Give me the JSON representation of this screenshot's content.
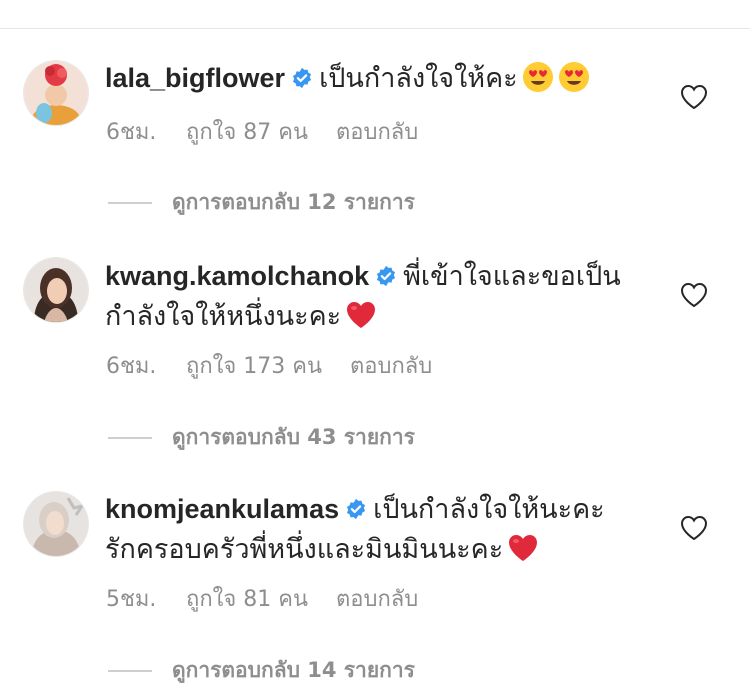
{
  "comments": [
    {
      "username": "lala_bigflower",
      "text_lines": [
        "เป็นกำลังใจให้คะ"
      ],
      "emoji": [
        "heart-eyes-emoji",
        "heart-eyes-emoji"
      ],
      "time": "6ชม.",
      "likes": "ถูกใจ 87 คน",
      "reply": "ตอบกลับ",
      "view_replies": "ดูการตอบกลับ 12 รายการ"
    },
    {
      "username": "kwang.kamolchanok",
      "text_lines": [
        "พี่เข้าใจและขอเป็น",
        "กำลังใจให้หนึ่งนะคะ"
      ],
      "emoji": [
        "red-heart-emoji"
      ],
      "time": "6ชม.",
      "likes": "ถูกใจ 173 คน",
      "reply": "ตอบกลับ",
      "view_replies": "ดูการตอบกลับ 43 รายการ"
    },
    {
      "username": "knomjeankulamas",
      "text_lines": [
        "เป็นกำลังใจให้นะคะ",
        "รักครอบครัวพี่หนึ่งและมินมินนะคะ"
      ],
      "emoji": [
        "red-heart-emoji"
      ],
      "time": "5ชม.",
      "likes": "ถูกใจ 81 คน",
      "reply": "ตอบกลับ",
      "view_replies": "ดูการตอบกลับ 14 รายการ"
    }
  ],
  "colors": {
    "text": "#262626",
    "secondary": "#8e8e8e",
    "verified": "#3897f0",
    "heart": "#ed4956"
  }
}
